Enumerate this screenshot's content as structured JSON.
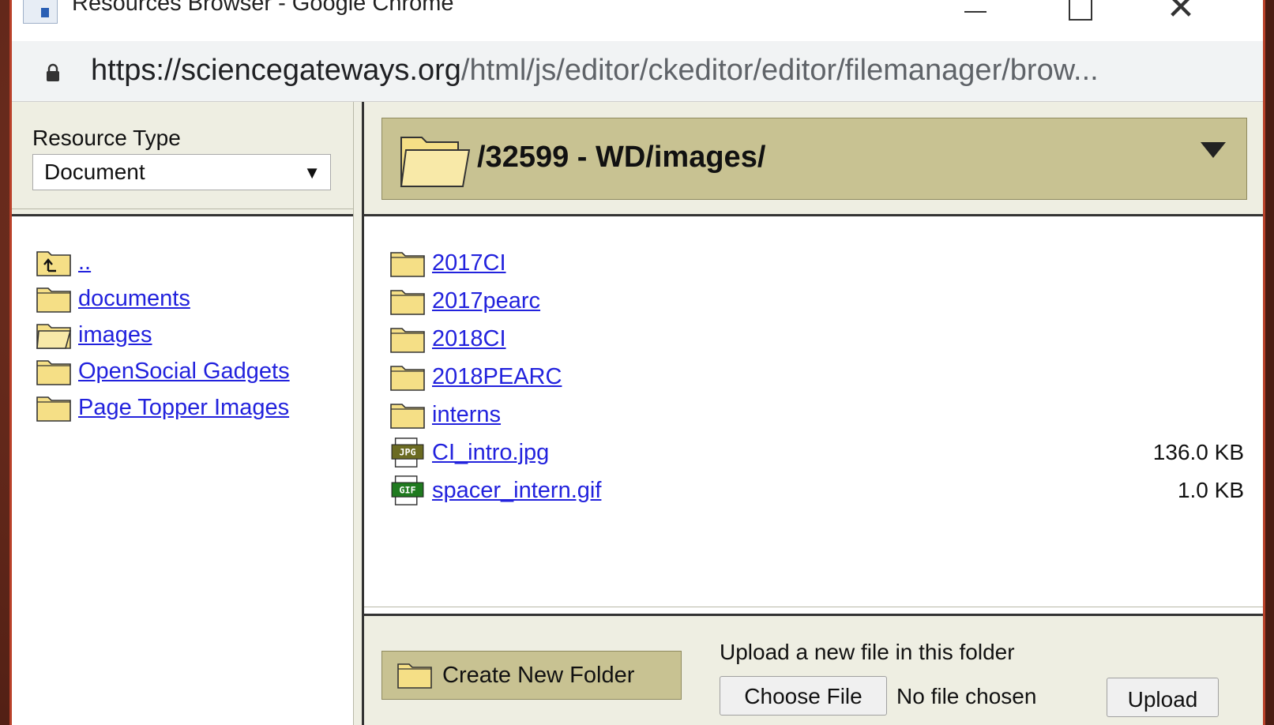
{
  "window": {
    "title": "Resources Browser - Google Chrome",
    "url_host": "https://sciencegateways.org",
    "url_path": "/html/js/editor/ckeditor/editor/filemanager/brow..."
  },
  "resource_type": {
    "label": "Resource Type",
    "selected": "Document"
  },
  "current_path": "/32599 - WD/images/",
  "left_folders": [
    {
      "name": "..",
      "icon": "folder-up-icon"
    },
    {
      "name": "documents",
      "icon": "folder-icon"
    },
    {
      "name": "images",
      "icon": "folder-open-icon"
    },
    {
      "name": "OpenSocial Gadgets",
      "icon": "folder-icon"
    },
    {
      "name": "Page Topper Images",
      "icon": "folder-icon"
    }
  ],
  "files": [
    {
      "name": "2017CI",
      "type": "folder",
      "size": ""
    },
    {
      "name": "2017pearc",
      "type": "folder",
      "size": ""
    },
    {
      "name": "2018CI",
      "type": "folder",
      "size": ""
    },
    {
      "name": "2018PEARC",
      "type": "folder",
      "size": ""
    },
    {
      "name": "interns",
      "type": "folder",
      "size": ""
    },
    {
      "name": "CI_intro.jpg",
      "type": "jpg",
      "size": "136.0 KB",
      "badge": "JPG"
    },
    {
      "name": "spacer_intern.gif",
      "type": "gif",
      "size": "1.0 KB",
      "badge": "GIF"
    }
  ],
  "bottom": {
    "create_folder": "Create New Folder",
    "upload_label": "Upload a new file in this folder",
    "choose_file": "Choose File",
    "no_file": "No file chosen",
    "upload": "Upload"
  },
  "colors": {
    "panel_bg": "#eeeee2",
    "accent_bar": "#c8c292",
    "link": "#2222dd",
    "folder_fill": "#f5df86"
  }
}
